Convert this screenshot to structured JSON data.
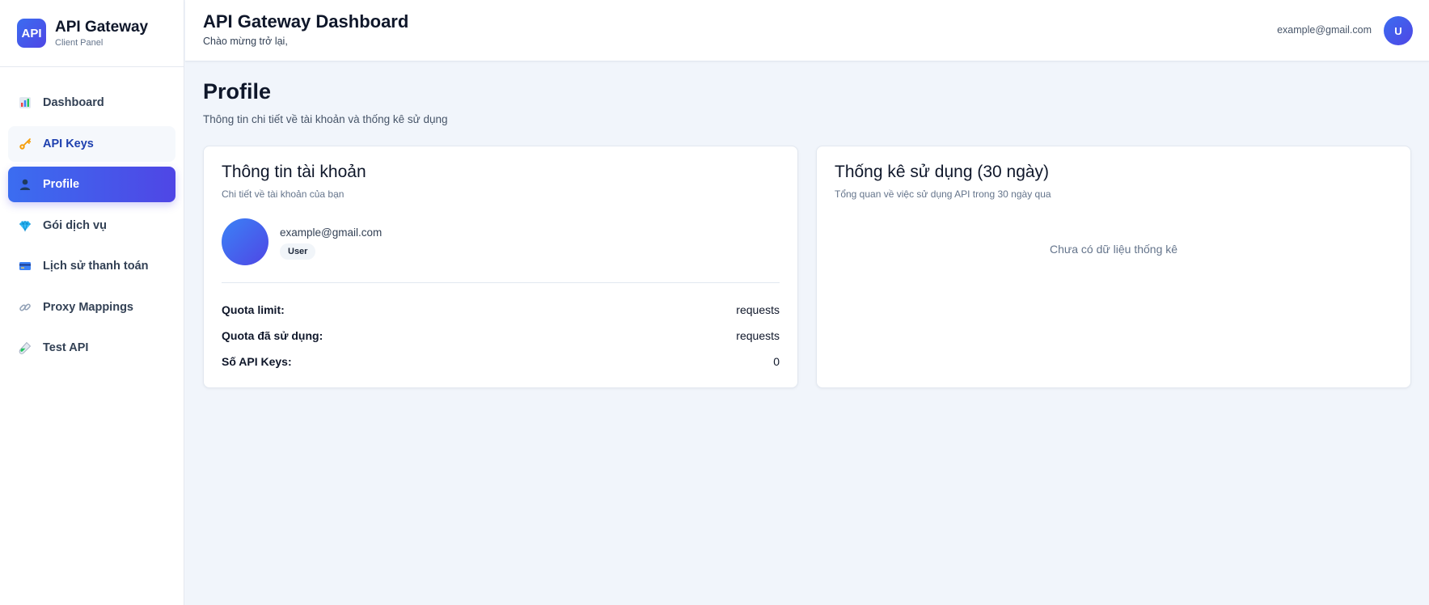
{
  "brand": {
    "logo_text": "API",
    "title": "API Gateway",
    "subtitle": "Client Panel"
  },
  "sidebar": {
    "items": [
      {
        "label": "Dashboard",
        "icon": "bar-chart-icon"
      },
      {
        "label": "API Keys",
        "icon": "key-icon"
      },
      {
        "label": "Profile",
        "icon": "user-icon"
      },
      {
        "label": "Gói dịch vụ",
        "icon": "diamond-icon"
      },
      {
        "label": "Lịch sử thanh toán",
        "icon": "credit-card-icon"
      },
      {
        "label": "Proxy Mappings",
        "icon": "link-icon"
      },
      {
        "label": "Test API",
        "icon": "test-tube-icon"
      }
    ]
  },
  "header": {
    "title": "API Gateway Dashboard",
    "subtitle": "Chào mừng trở lại,",
    "user_email": "example@gmail.com",
    "avatar_initial": "U"
  },
  "page": {
    "title": "Profile",
    "subtitle": "Thông tin chi tiết về tài khoản và thống kê sử dụng"
  },
  "account_card": {
    "title": "Thông tin tài khoản",
    "subtitle": "Chi tiết về tài khoản của bạn",
    "email": "example@gmail.com",
    "role": "User",
    "stats": [
      {
        "label": "Quota limit:",
        "value": "requests"
      },
      {
        "label": "Quota đã sử dụng:",
        "value": "requests"
      },
      {
        "label": "Số API Keys:",
        "value": "0"
      }
    ]
  },
  "usage_card": {
    "title": "Thống kê sử dụng (30 ngày)",
    "subtitle": "Tổng quan về việc sử dụng API trong 30 ngày qua",
    "empty_message": "Chưa có dữ liệu thống kê"
  },
  "colors": {
    "accent_start": "#3b6df0",
    "accent_end": "#4f46e5",
    "background": "#f1f5fb"
  }
}
